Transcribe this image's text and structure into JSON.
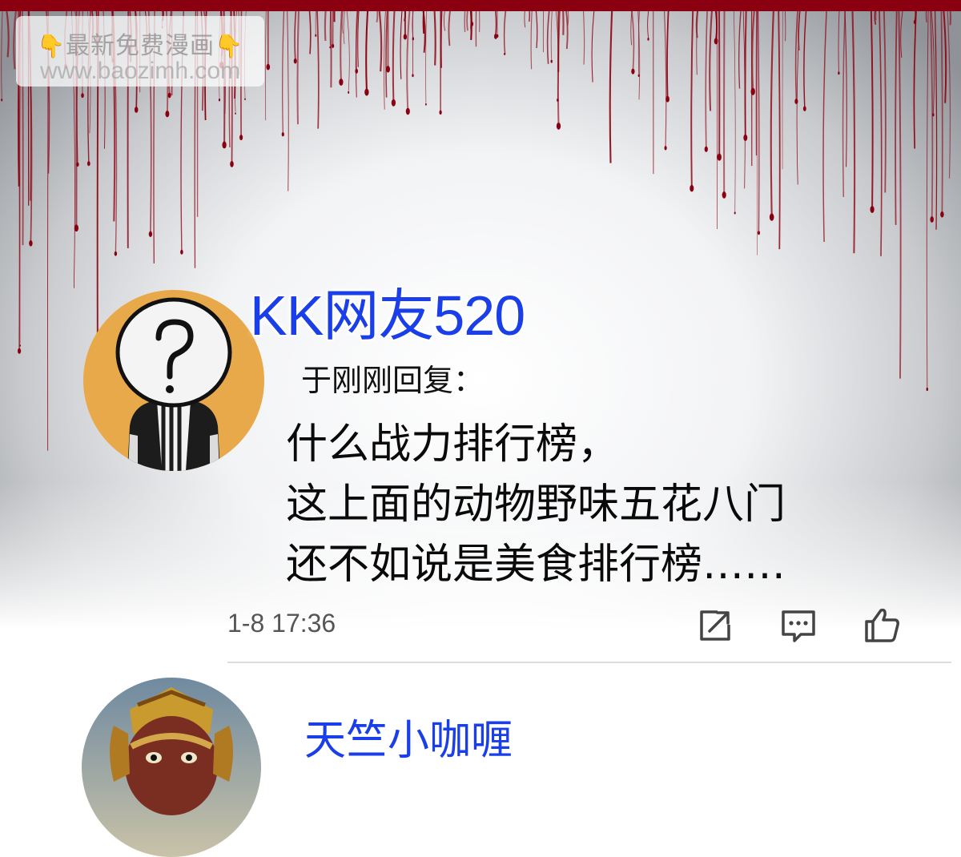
{
  "watermark": {
    "line1": "最新免费漫画",
    "line1_icon": "pointing-down-hand",
    "line2": "www.baozimh.com"
  },
  "comment": {
    "username": "KK网友520",
    "reply_meta": "于刚刚回复：",
    "body_lines": [
      "什么战力排行榜，",
      "这上面的动物野味五花八门",
      "还不如说是美食排行榜……"
    ],
    "timestamp": "1-8 17:36",
    "actions": [
      "share-icon",
      "reply-icon",
      "like-icon"
    ]
  },
  "next_comment": {
    "username": "天竺小咖喱"
  },
  "colors": {
    "username": "#1a3fe8",
    "blood": "#8b0010",
    "avatar_bg": "#e8a94a"
  }
}
